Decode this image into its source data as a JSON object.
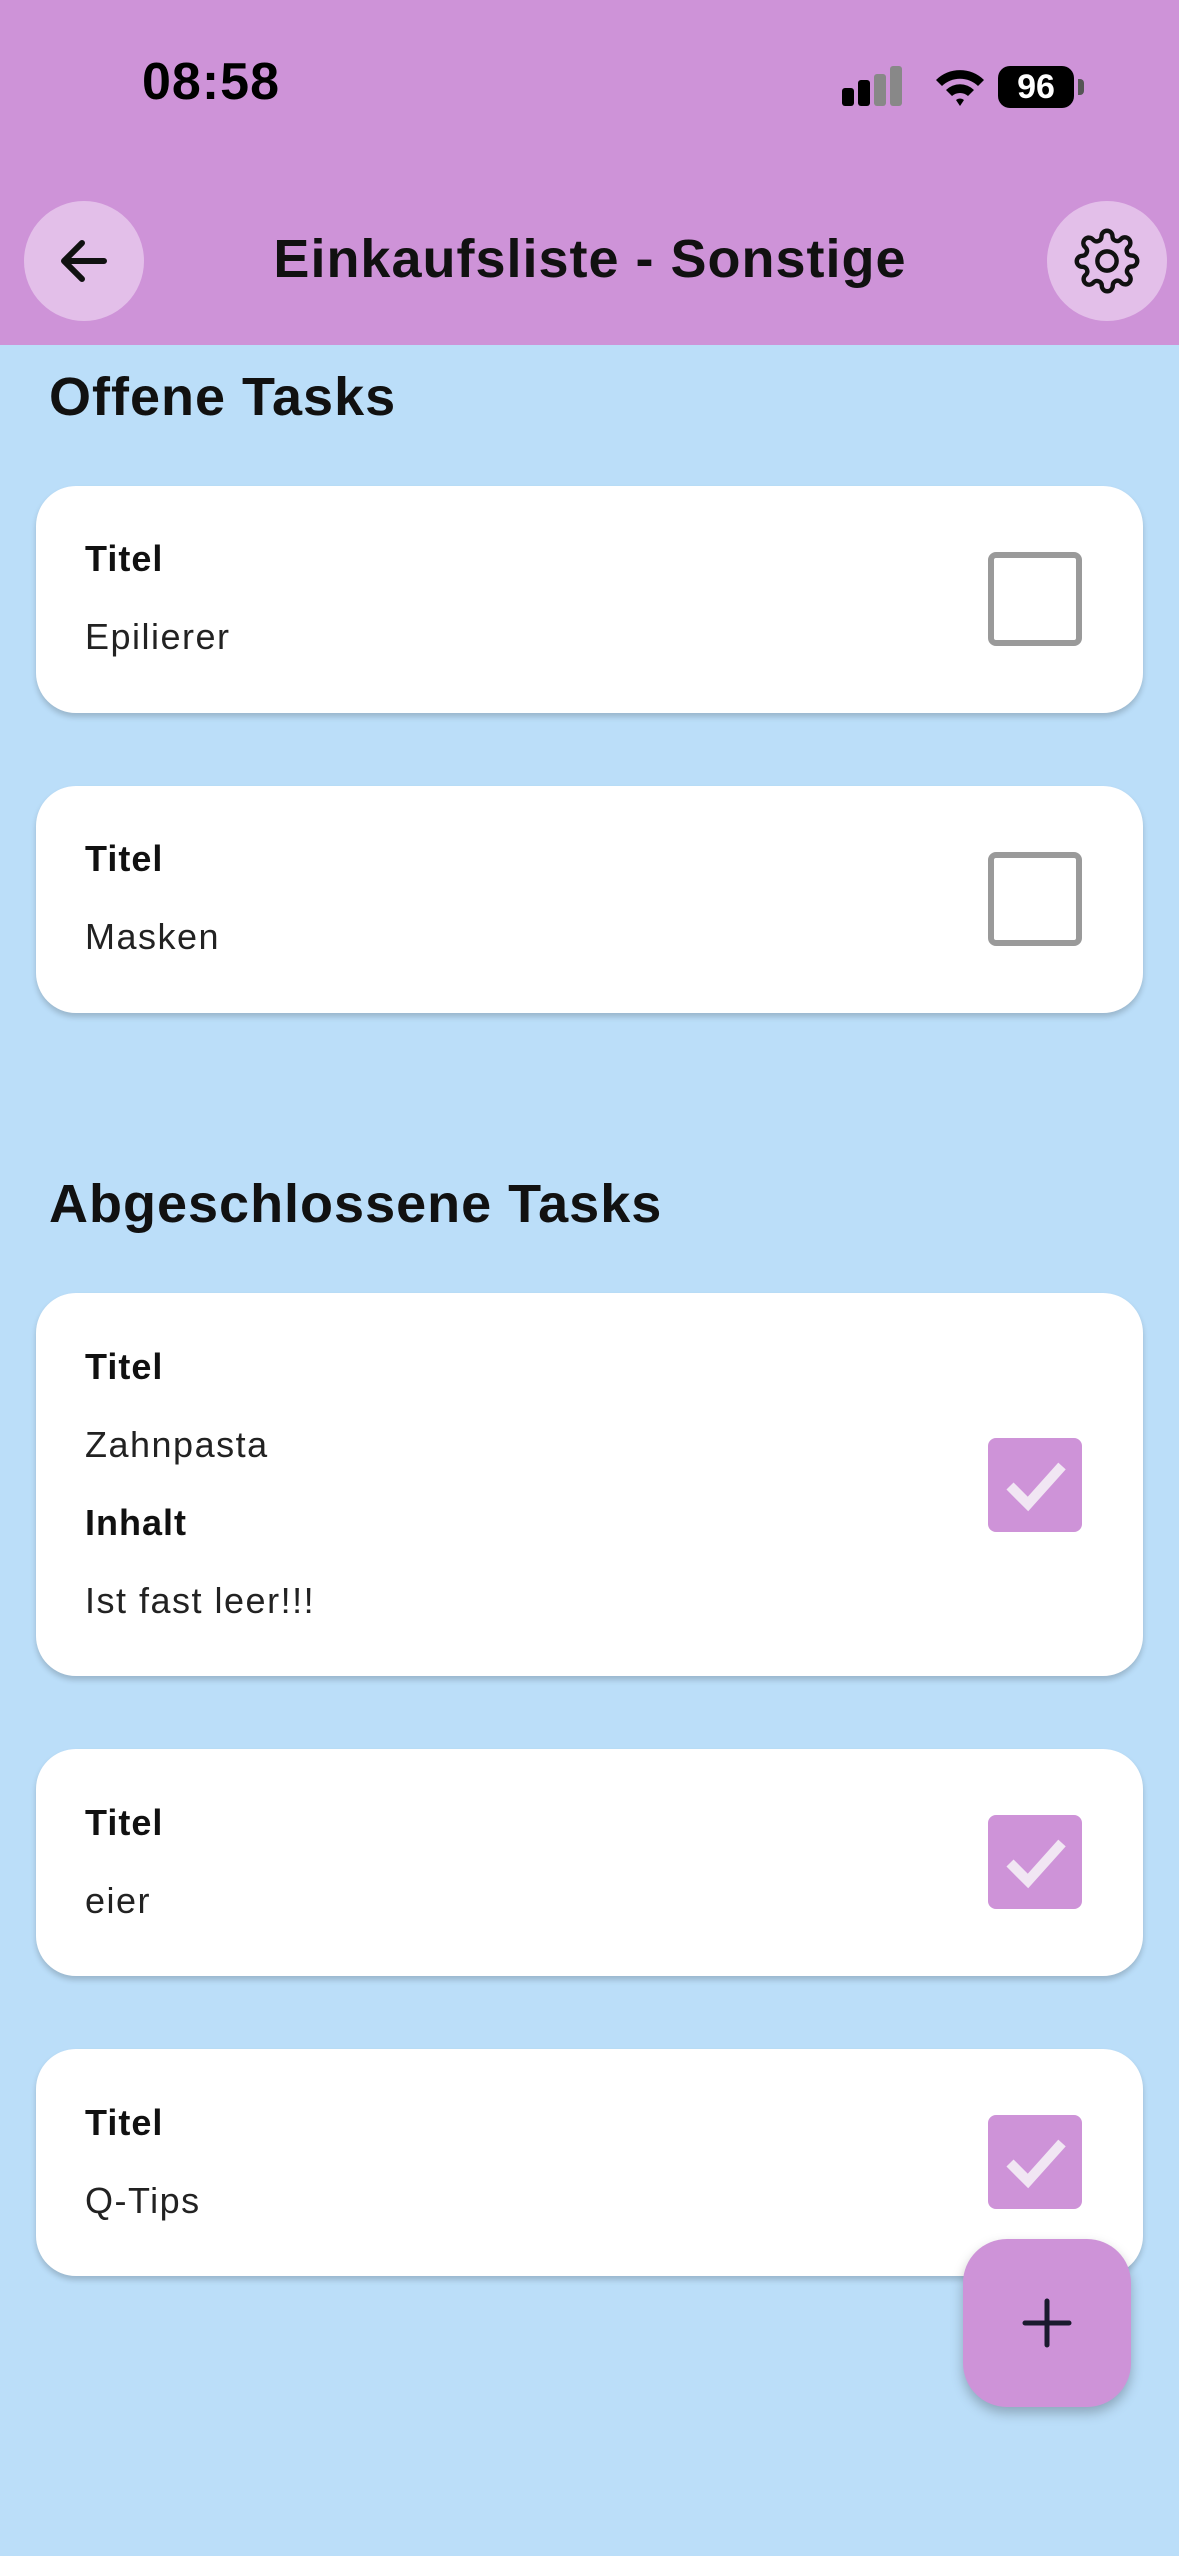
{
  "status_bar": {
    "time": "08:58",
    "battery": "96"
  },
  "app_bar": {
    "title": "Einkaufsliste - Sonstige",
    "back_icon": "arrow-left-icon",
    "settings_icon": "gear-icon"
  },
  "colors": {
    "accent": "#ce93d8",
    "background": "#bbdef9",
    "card": "#ffffff"
  },
  "open_section": {
    "title": "Offene Tasks",
    "tasks": [
      {
        "title_label": "Titel",
        "title": "Epilierer",
        "done": false
      },
      {
        "title_label": "Titel",
        "title": "Masken",
        "done": false
      }
    ]
  },
  "done_section": {
    "title": "Abgeschlossene Tasks",
    "tasks": [
      {
        "title_label": "Titel",
        "title": "Zahnpasta",
        "content_label": "Inhalt",
        "content": "Ist fast leer!!!",
        "done": true
      },
      {
        "title_label": "Titel",
        "title": "eier",
        "done": true
      },
      {
        "title_label": "Titel",
        "title": "Q-Tips",
        "done": true
      }
    ]
  },
  "fab": {
    "icon": "plus-icon"
  }
}
